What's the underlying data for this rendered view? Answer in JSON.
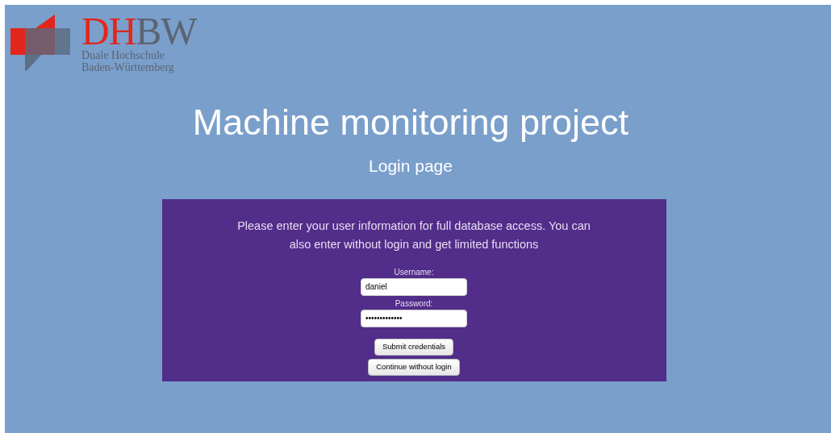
{
  "logo": {
    "red_letters": "DH",
    "gray_letters": "BW",
    "lines": [
      "Duale Hochschule",
      "Baden-Württemberg"
    ]
  },
  "title": "Machine monitoring project",
  "subtitle": "Login page",
  "login_panel": {
    "message": "Please enter your user information for full database access. You can also enter without login and get limited functions",
    "fields": [
      {
        "label": "Username:",
        "value": "daniel"
      },
      {
        "label": "Password:",
        "value": "•••••••••••••"
      }
    ],
    "buttons": [
      "Submit credentials",
      "Continue without login"
    ]
  }
}
